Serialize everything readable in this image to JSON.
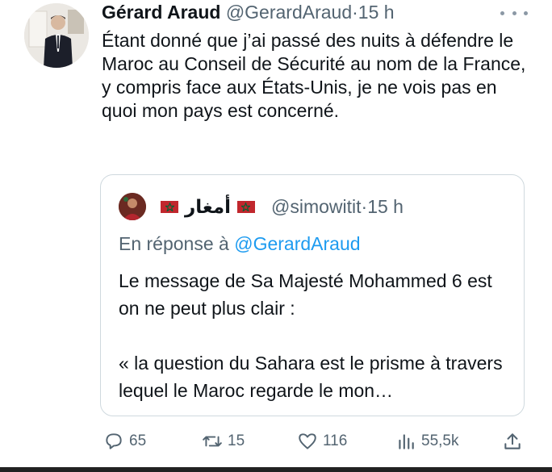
{
  "tweet": {
    "author_name": "Gérard Araud",
    "author_handle": "@GerardAraud",
    "separator": "·",
    "time": "15 h",
    "text": "Étant donné que j’ai passé des nuits à défendre le Maroc au Conseil de Sécurité au nom de la France, y compris face aux États-Unis, je ne vois pas en quoi mon pays est concerné.",
    "more_icon": "more-dots-icon"
  },
  "quote": {
    "author_name": "أمغار",
    "author_flag": "morocco-flag-icon",
    "author_handle": "@simowitit",
    "separator": "·",
    "time": "15 h",
    "reply_prefix": "En réponse à",
    "reply_handle": "@GerardAraud",
    "paragraph1": "Le message de Sa Majesté Mohammed 6 est on ne peut plus clair :",
    "paragraph2": "«  la question du Sahara est le prisme à travers lequel le Maroc regarde le mon…"
  },
  "actions": {
    "replies": "65",
    "retweets": "15",
    "likes": "116",
    "views": "55,5k"
  },
  "colors": {
    "text": "#0f1419",
    "muted": "#536471",
    "link": "#1d9bf0",
    "border": "#cfd9de",
    "flag_red": "#c1272d",
    "flag_green": "#006233"
  }
}
